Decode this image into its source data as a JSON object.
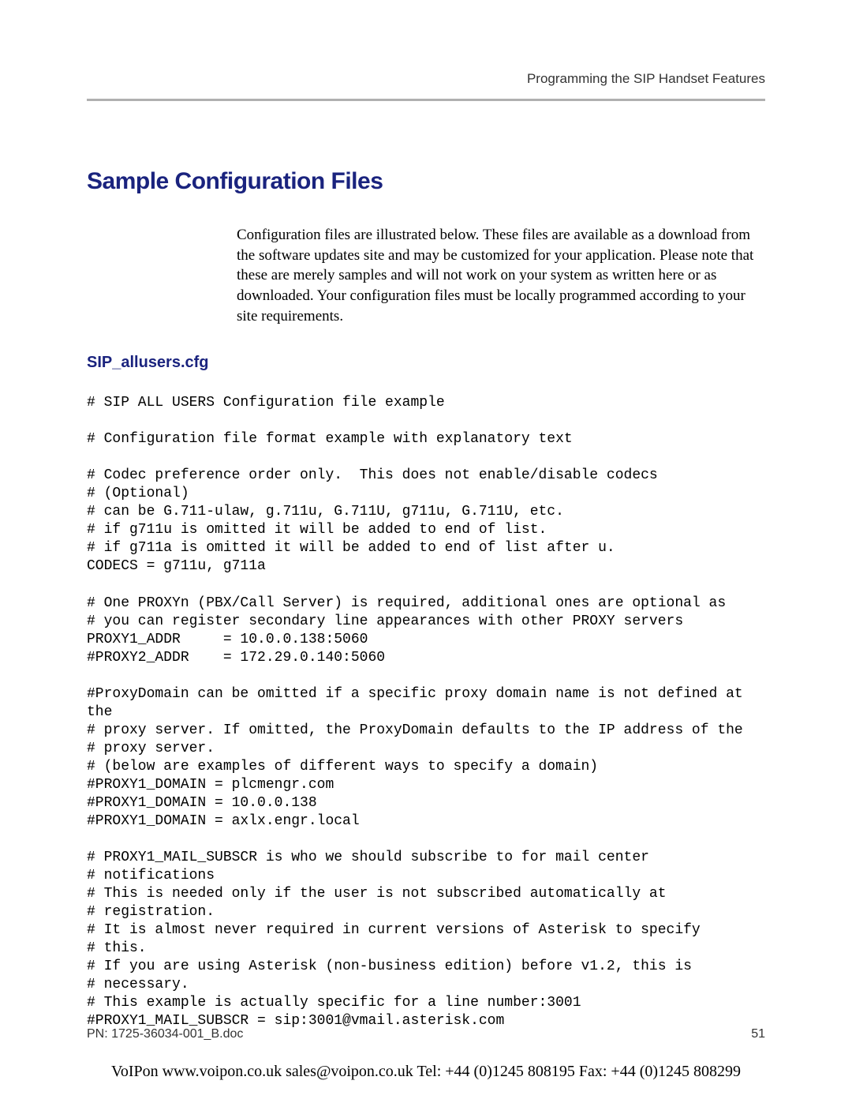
{
  "header": {
    "section_title": "Programming the SIP Handset Features"
  },
  "headings": {
    "main": "Sample Configuration Files",
    "subsection": "SIP_allusers.cfg"
  },
  "intro": "Configuration files are illustrated below. These files are available as a download from the software updates site and may be customized for your application. Please note that these are merely samples and will not work on your system as written here or as downloaded. Your configuration files must be locally programmed according to your site requirements.",
  "config_content": "# SIP ALL USERS Configuration file example\n\n# Configuration file format example with explanatory text\n\n# Codec preference order only.  This does not enable/disable codecs\n# (Optional)\n# can be G.711-ulaw, g.711u, G.711U, g711u, G.711U, etc.\n# if g711u is omitted it will be added to end of list.\n# if g711a is omitted it will be added to end of list after u.\nCODECS = g711u, g711a\n\n# One PROXYn (PBX/Call Server) is required, additional ones are optional as\n# you can register secondary line appearances with other PROXY servers\nPROXY1_ADDR     = 10.0.0.138:5060\n#PROXY2_ADDR    = 172.29.0.140:5060\n\n#ProxyDomain can be omitted if a specific proxy domain name is not defined at\nthe\n# proxy server. If omitted, the ProxyDomain defaults to the IP address of the\n# proxy server.\n# (below are examples of different ways to specify a domain)\n#PROXY1_DOMAIN = plcmengr.com\n#PROXY1_DOMAIN = 10.0.0.138\n#PROXY1_DOMAIN = axlx.engr.local\n\n# PROXY1_MAIL_SUBSCR is who we should subscribe to for mail center\n# notifications\n# This is needed only if the user is not subscribed automatically at\n# registration.\n# It is almost never required in current versions of Asterisk to specify\n# this.\n# If you are using Asterisk (non-business edition) before v1.2, this is\n# necessary.\n# This example is actually specific for a line number:3001\n#PROXY1_MAIL_SUBSCR = sip:3001@vmail.asterisk.com",
  "footer": {
    "doc_id": "PN: 1725-36034-001_B.doc",
    "page_number": "51"
  },
  "contact": "VoIPon   www.voipon.co.uk   sales@voipon.co.uk   Tel: +44 (0)1245 808195    Fax: +44 (0)1245 808299"
}
